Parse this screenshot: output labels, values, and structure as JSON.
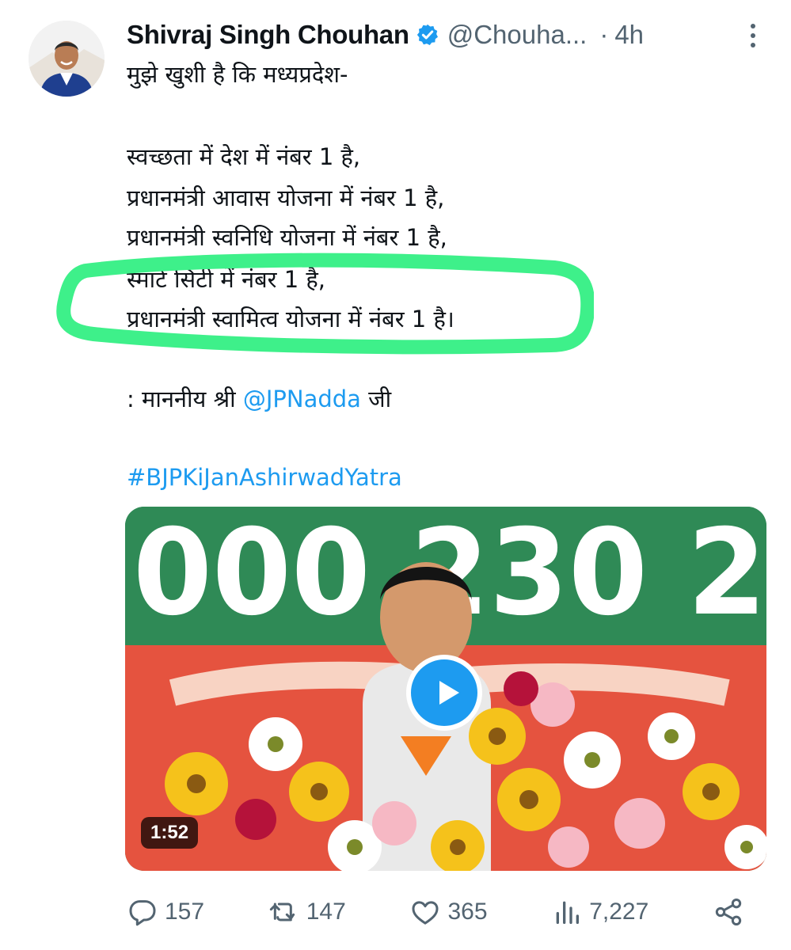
{
  "author": {
    "display_name": "Shivraj Singh Chouhan",
    "handle": "@Chouha...",
    "separator": "·",
    "time": "4h"
  },
  "tweet": {
    "intro": "मुझे खुशी है कि मध्यप्रदेश-",
    "lines": [
      "स्वच्छता में देश में नंबर 1 है,",
      "प्रधानमंत्री आवास योजना में नंबर 1 है,",
      "प्रधानमंत्री स्वनिधि योजना में नंबर 1 है,",
      "स्मार्ट सिटी में नंबर 1 है,",
      "प्रधानमंत्री स्वामित्व योजना में नंबर 1 है।"
    ],
    "quote_prefix": ": माननीय श्री ",
    "mention": "@JPNadda",
    "quote_suffix": " जी",
    "hashtag": "#BJPKiJanAshirwadYatra"
  },
  "media": {
    "banner_text": "000 230 2",
    "duration": "1:52"
  },
  "stats": {
    "replies": "157",
    "retweets": "147",
    "likes": "365",
    "views": "7,227"
  },
  "colors": {
    "accent": "#1d9bf0",
    "text": "#0f1419",
    "secondary": "#536471",
    "highlight": "#3ef08a"
  },
  "icons": {
    "more": "more-icon",
    "verified": "verified-badge-icon",
    "play": "play-icon",
    "reply": "reply-icon",
    "retweet": "retweet-icon",
    "like": "like-icon",
    "views": "views-icon",
    "share": "share-icon"
  }
}
